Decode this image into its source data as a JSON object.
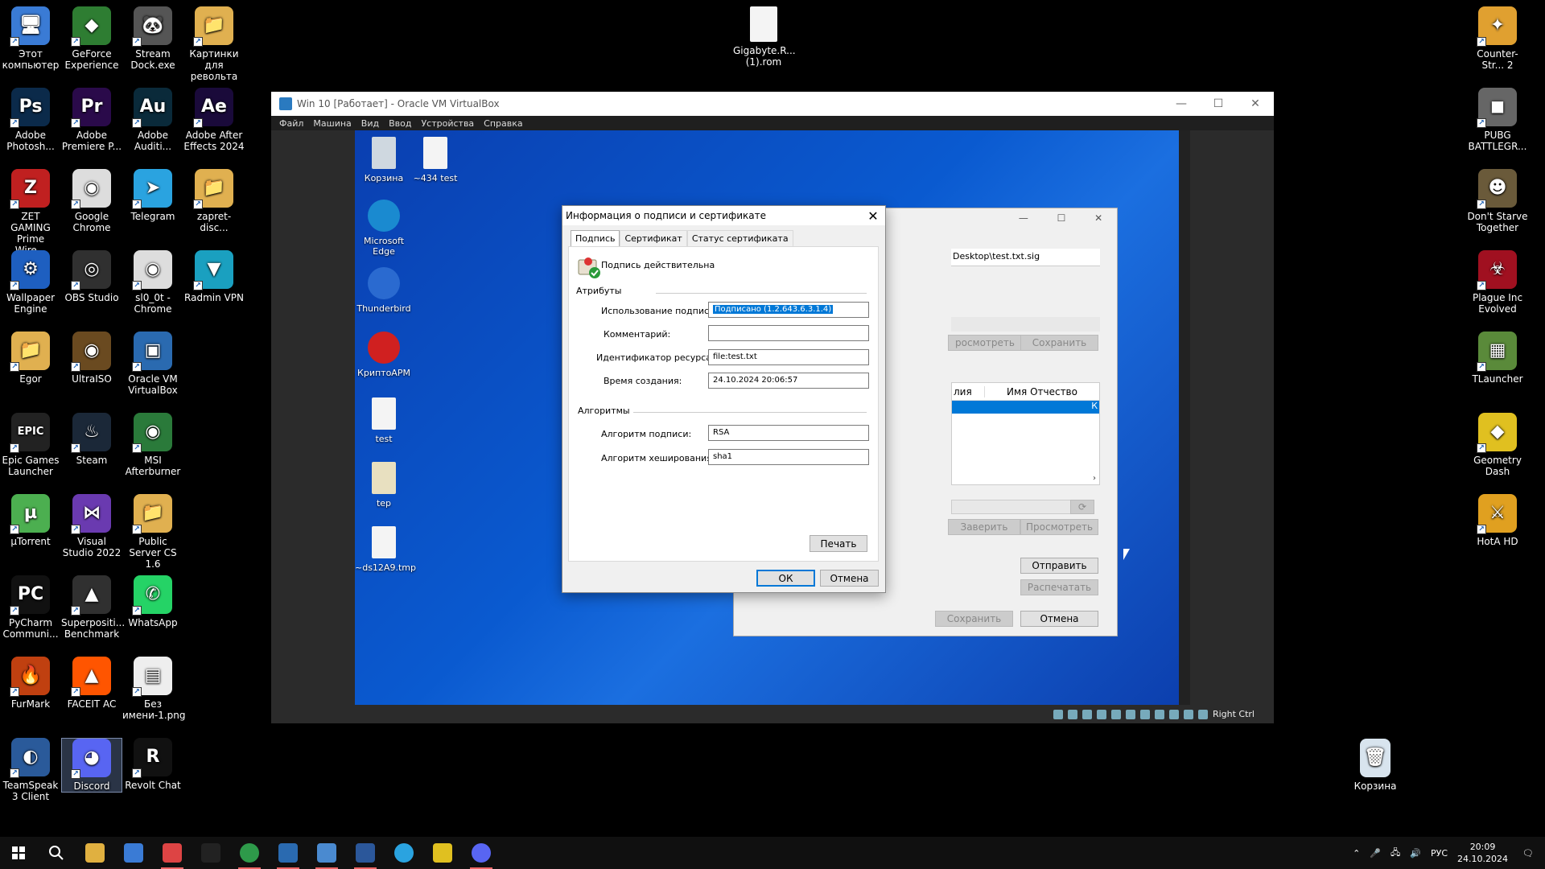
{
  "desktop": {
    "left_icons": [
      {
        "label": "Этот компьютер",
        "color": "#3a7bd5",
        "glyph": "🖥",
        "col": 0,
        "row": 0
      },
      {
        "label": "GeForce Experience",
        "color": "#2e7d32",
        "glyph": "◆",
        "col": 1,
        "row": 0
      },
      {
        "label": "Stream Dock.exe",
        "color": "#555555",
        "glyph": "🐼",
        "col": 2,
        "row": 0
      },
      {
        "label": "Картинки для револьта",
        "color": "#e0b050",
        "glyph": "📁",
        "col": 3,
        "row": 0
      },
      {
        "label": "Adobe Photosh...",
        "color": "#0b2a4a",
        "glyph": "Ps",
        "col": 0,
        "row": 1
      },
      {
        "label": "Adobe Premiere P...",
        "color": "#2a0a4a",
        "glyph": "Pr",
        "col": 1,
        "row": 1
      },
      {
        "label": "Adobe Auditi...",
        "color": "#0a2a3a",
        "glyph": "Au",
        "col": 2,
        "row": 1
      },
      {
        "label": "Adobe After Effects 2024",
        "color": "#1a0a3a",
        "glyph": "Ae",
        "col": 3,
        "row": 1
      },
      {
        "label": "ZET GAMING Prime Wire...",
        "color": "#c02020",
        "glyph": "Z",
        "col": 0,
        "row": 2
      },
      {
        "label": "Google Chrome",
        "color": "#dddddd",
        "glyph": "◉",
        "col": 1,
        "row": 2
      },
      {
        "label": "Telegram",
        "color": "#2aa3e0",
        "glyph": "➤",
        "col": 2,
        "row": 2
      },
      {
        "label": "zapret-disc...",
        "color": "#e0b050",
        "glyph": "📁",
        "col": 3,
        "row": 2
      },
      {
        "label": "Wallpaper Engine",
        "color": "#1e5fc0",
        "glyph": "⚙",
        "col": 0,
        "row": 3
      },
      {
        "label": "OBS Studio",
        "color": "#303030",
        "glyph": "◎",
        "col": 1,
        "row": 3
      },
      {
        "label": "sl0_0t - Chrome",
        "color": "#dddddd",
        "glyph": "◉",
        "col": 2,
        "row": 3
      },
      {
        "label": "Radmin VPN",
        "color": "#1aa0c0",
        "glyph": "▼",
        "col": 3,
        "row": 3
      },
      {
        "label": "Egor",
        "color": "#e0b050",
        "glyph": "📁",
        "col": 0,
        "row": 4
      },
      {
        "label": "UltraISO",
        "color": "#6a4a20",
        "glyph": "◉",
        "col": 1,
        "row": 4
      },
      {
        "label": "Oracle VM VirtualBox",
        "color": "#2a6ab0",
        "glyph": "▣",
        "col": 2,
        "row": 4
      },
      {
        "label": "Epic Games Launcher",
        "color": "#222222",
        "glyph": "EPIC",
        "col": 0,
        "row": 5
      },
      {
        "label": "Steam",
        "color": "#1b2838",
        "glyph": "♨",
        "col": 1,
        "row": 5
      },
      {
        "label": "MSI Afterburner",
        "color": "#2a7a3a",
        "glyph": "◉",
        "col": 2,
        "row": 5
      },
      {
        "label": "µTorrent",
        "color": "#4caf50",
        "glyph": "µ",
        "col": 0,
        "row": 6
      },
      {
        "label": "Visual Studio 2022",
        "color": "#6a3ab0",
        "glyph": "⋈",
        "col": 1,
        "row": 6
      },
      {
        "label": "Public Server CS 1.6",
        "color": "#e0b050",
        "glyph": "📁",
        "col": 2,
        "row": 6
      },
      {
        "label": "PyCharm Communi...",
        "color": "#111111",
        "glyph": "PC",
        "col": 0,
        "row": 7
      },
      {
        "label": "Superpositi... Benchmark",
        "color": "#303030",
        "glyph": "▲",
        "col": 1,
        "row": 7
      },
      {
        "label": "WhatsApp",
        "color": "#25d366",
        "glyph": "✆",
        "col": 2,
        "row": 7
      },
      {
        "label": "FurMark",
        "color": "#c04010",
        "glyph": "🔥",
        "col": 0,
        "row": 8
      },
      {
        "label": "FACEIT AC",
        "color": "#ff5500",
        "glyph": "▲",
        "col": 1,
        "row": 8
      },
      {
        "label": "Без имени-1.png",
        "color": "#eeeeee",
        "glyph": "▤",
        "col": 2,
        "row": 8
      },
      {
        "label": "TeamSpeak 3 Client",
        "color": "#2a5a9a",
        "glyph": "◐",
        "col": 0,
        "row": 9
      },
      {
        "label": "Discord",
        "color": "#5865f2",
        "glyph": "◕",
        "col": 1,
        "row": 9,
        "selected": true
      },
      {
        "label": "Revolt Chat",
        "color": "#111111",
        "glyph": "R",
        "col": 2,
        "row": 9
      }
    ],
    "center_icon": {
      "label": "Gigabyte.R... (1).rom",
      "color": "#f4f4f4",
      "glyph": "▯"
    },
    "right_icons": [
      {
        "label": "Counter-Str... 2",
        "color": "#e0a030",
        "glyph": "✦",
        "row": 0
      },
      {
        "label": "PUBG BATTLEGR...",
        "color": "#666666",
        "glyph": "◼",
        "row": 1
      },
      {
        "label": "Don't Starve Together",
        "color": "#6a5a3a",
        "glyph": "☻",
        "row": 2
      },
      {
        "label": "Plague Inc Evolved",
        "color": "#a01020",
        "glyph": "☣",
        "row": 3
      },
      {
        "label": "TLauncher",
        "color": "#5a8a3a",
        "glyph": "▦",
        "row": 4
      },
      {
        "label": "Geometry Dash",
        "color": "#e0c020",
        "glyph": "◆",
        "row": 5
      },
      {
        "label": "HotA HD",
        "color": "#e0a020",
        "glyph": "⚔",
        "row": 6
      }
    ],
    "recycle_bin": {
      "label": "Корзина"
    }
  },
  "vbox": {
    "title": "Win 10 [Работает] - Oracle VM VirtualBox",
    "menu": [
      "Файл",
      "Машина",
      "Вид",
      "Ввод",
      "Устройства",
      "Справка"
    ],
    "status_key": "Right Ctrl",
    "guest_icons": [
      {
        "label": "Корзина"
      },
      {
        "label": "~434 test"
      },
      {
        "label": "Microsoft Edge"
      },
      {
        "label": "Thunderbird"
      },
      {
        "label": "КриптоАРМ"
      },
      {
        "label": "test"
      },
      {
        "label": "tep"
      },
      {
        "label": "~ds12A9.tmp"
      }
    ]
  },
  "bg_window": {
    "path_value": "Desktop\\test.txt.sig",
    "btn_view": "росмотреть",
    "btn_save1": "Сохранить",
    "col_a": "лия",
    "col_b": "Имя Отчество",
    "row_cell": "К",
    "btn_certify": "Заверить",
    "btn_view2": "Просмотреть",
    "btn_send": "Отправить",
    "btn_print": "Распечатать",
    "btn_save2": "Сохранить",
    "btn_cancel": "Отмена"
  },
  "dialog": {
    "title": "Информация о подписи и сертификате",
    "tabs": [
      "Подпись",
      "Сертификат",
      "Статус сертификата"
    ],
    "status": "Подпись действительна",
    "attributes_heading": "Атрибуты",
    "fields": [
      {
        "label": "Использование подписи:",
        "value": "Подписано (1.2.643.6.3.1.4)"
      },
      {
        "label": "Комментарий:",
        "value": ""
      },
      {
        "label": "Идентификатор ресурса:",
        "value": "file:test.txt"
      },
      {
        "label": "Время создания:",
        "value": "24.10.2024 20:06:57"
      }
    ],
    "algorithms_heading": "Алгоритмы",
    "alg_fields": [
      {
        "label": "Алгоритм подписи:",
        "value": "RSA"
      },
      {
        "label": "Алгоритм хеширования:",
        "value": "sha1"
      }
    ],
    "print_button": "Печать",
    "ok_button": "ОК",
    "cancel_button": "Отмена"
  },
  "taskbar": {
    "language": "РУС",
    "time": "20:09",
    "date": "24.10.2024"
  }
}
